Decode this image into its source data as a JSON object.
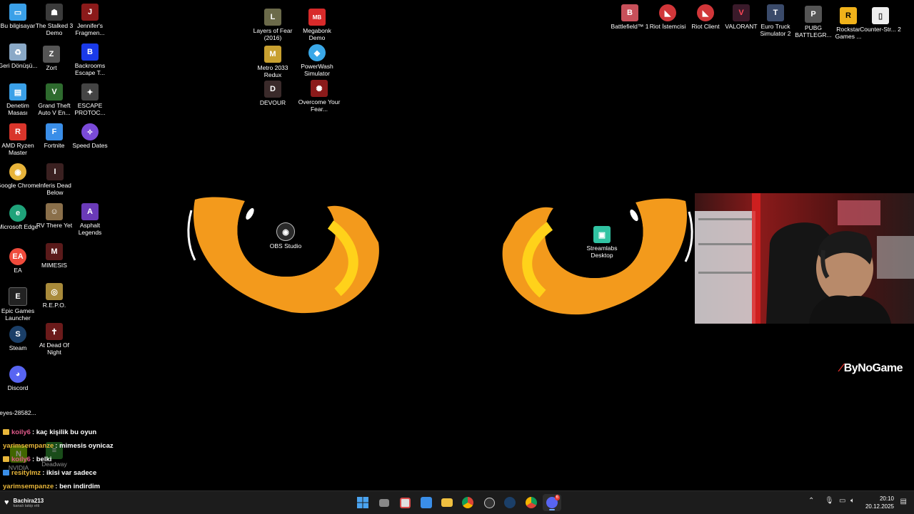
{
  "desktop": {
    "left_column_1": [
      {
        "label": "Bu bilgisayar",
        "icon": "monitor-icon",
        "color": "#3aa0e8",
        "glyph": "▭"
      },
      {
        "label": "Geri Dönüşü...",
        "icon": "recycle-bin-icon",
        "color": "#8aa9c7",
        "glyph": "♻"
      },
      {
        "label": "Denetim Masası",
        "icon": "control-panel-icon",
        "color": "#3aa0e8",
        "glyph": "▤"
      },
      {
        "label": "AMD Ryzen Master",
        "icon": "amd-ryzen-icon",
        "color": "#d9352b",
        "glyph": "R"
      },
      {
        "label": "Google Chrome",
        "icon": "chrome-icon",
        "color": "#e8b43a",
        "glyph": "◉"
      },
      {
        "label": "Microsoft Edge",
        "icon": "edge-icon",
        "color": "#1fa37a",
        "glyph": "e"
      },
      {
        "label": "EA",
        "icon": "ea-icon",
        "color": "#ef4b3c",
        "glyph": "EA"
      },
      {
        "label": "Epic Games Launcher",
        "icon": "epic-games-icon",
        "color": "#222",
        "glyph": "E"
      },
      {
        "label": "Steam",
        "icon": "steam-icon",
        "color": "#1b3f68",
        "glyph": "S"
      },
      {
        "label": "Discord",
        "icon": "discord-icon",
        "color": "#5865f2",
        "glyph": "◕"
      }
    ],
    "left_column_2": [
      {
        "label": "The Stalked 3 Demo",
        "icon": "stalked-icon",
        "color": "#3b3b3b",
        "glyph": "☗"
      },
      {
        "label": "Zort",
        "icon": "zort-icon",
        "color": "#555",
        "glyph": "Z"
      },
      {
        "label": "Grand Theft Auto V En...",
        "icon": "gta-icon",
        "color": "#2e6b2e",
        "glyph": "V"
      },
      {
        "label": "Fortnite",
        "icon": "fortnite-icon",
        "color": "#3a8ee8",
        "glyph": "F"
      },
      {
        "label": "Inferis Dead Below",
        "icon": "inferis-icon",
        "color": "#3a2020",
        "glyph": "I"
      },
      {
        "label": "RV There Yet",
        "icon": "rv-icon",
        "color": "#8a6f4a",
        "glyph": "☺"
      },
      {
        "label": "MIMESIS",
        "icon": "mimesis-icon",
        "color": "#5a1a1a",
        "glyph": "M"
      },
      {
        "label": "R.E.P.O.",
        "icon": "repo-icon",
        "color": "#a88a3a",
        "glyph": "◎"
      },
      {
        "label": "At Dead Of Night",
        "icon": "at-dead-of-night-icon",
        "color": "#6b1a1a",
        "glyph": "✝"
      }
    ],
    "left_column_3": [
      {
        "label": "Jennifer's Fragmen...",
        "icon": "jennifer-icon",
        "color": "#8b1a1a",
        "glyph": "J"
      },
      {
        "label": "Backrooms Escape T...",
        "icon": "backrooms-icon",
        "color": "#1a3ae8",
        "glyph": "B"
      },
      {
        "label": "ESCAPE PROTOC...",
        "icon": "escape-protocol-icon",
        "color": "#444",
        "glyph": "✦"
      },
      {
        "label": "Speed Dates",
        "icon": "speed-dates-icon",
        "color": "#7a4ad8",
        "glyph": "✧"
      },
      {
        "label": "Asphalt Legends",
        "icon": "asphalt-icon",
        "color": "#6a3ab8",
        "glyph": "A"
      }
    ],
    "middle_column_1": [
      {
        "label": "Layers of Fear (2016)",
        "icon": "layers-of-fear-icon",
        "color": "#6b6a4a",
        "glyph": "L"
      },
      {
        "label": "Metro 2033 Redux",
        "icon": "metro-icon",
        "color": "#c8a030",
        "glyph": "M"
      },
      {
        "label": "DEVOUR",
        "icon": "devour-icon",
        "color": "#3a2a2a",
        "glyph": "D"
      }
    ],
    "middle_column_2": [
      {
        "label": "Megabonk Demo",
        "icon": "megabonk-icon",
        "color": "#d82a2a",
        "glyph": "MB"
      },
      {
        "label": "PowerWash Simulator",
        "icon": "powerwash-icon",
        "color": "#3aa8e8",
        "glyph": "◆"
      },
      {
        "label": "Overcome Your Fear...",
        "icon": "overcome-icon",
        "color": "#8b1a1a",
        "glyph": "✺"
      }
    ],
    "center_icons": [
      {
        "label": "OBS Studio",
        "icon": "obs-icon",
        "color": "#2a2a2a",
        "glyph": "◉"
      },
      {
        "label": "Streamlabs Desktop",
        "icon": "streamlabs-icon",
        "color": "#31c3a2",
        "glyph": "▣"
      }
    ],
    "top_right": [
      {
        "label": "Battlefield™ 1",
        "icon": "battlefield-icon",
        "color": "#c8505a",
        "glyph": "B"
      },
      {
        "label": "Riot İstemcisi",
        "icon": "riot-client-icon",
        "color": "#d13639",
        "glyph": "◣"
      },
      {
        "label": "Riot Client",
        "icon": "riot-client-2-icon",
        "color": "#d13639",
        "glyph": "◣"
      },
      {
        "label": "VALORANT",
        "icon": "valorant-icon",
        "color": "#3a1a2a",
        "glyph": "V"
      },
      {
        "label": "Euro Truck Simulator 2",
        "icon": "euro-truck-icon",
        "color": "#3a4a6a",
        "glyph": "T"
      },
      {
        "label": "PUBG BATTLEGR...",
        "icon": "pubg-icon",
        "color": "#555",
        "glyph": "P"
      },
      {
        "label": "Rockstar Games ...",
        "icon": "rockstar-icon",
        "color": "#f0b21a",
        "glyph": "R"
      },
      {
        "label": "Counter-Str... 2",
        "icon": "counter-strike-icon",
        "color": "#eee",
        "glyph": "▯"
      }
    ],
    "partial_icons": [
      {
        "label": "eyes-28582...",
        "icon": "image-file-icon"
      },
      {
        "label": "NVIDIA",
        "icon": "nvidia-icon"
      },
      {
        "label": "Deadway",
        "icon": "deadway-icon"
      }
    ]
  },
  "overlay": {
    "brand": "ByNoGame",
    "chat": [
      {
        "user": "koily6",
        "message": ": kaç kişilik bu oyun",
        "color": "#e05a8a",
        "badge": true
      },
      {
        "user": "yarimsempanze",
        "message": ": mimesis oynicaz",
        "color": "#e8b63a",
        "badge": false
      },
      {
        "user": "koily6",
        "message": ": belki",
        "color": "#e05a8a",
        "badge": true
      },
      {
        "user": "resitylmz",
        "message": ": ikisi var sadece",
        "color": "#e8b63a",
        "badge": true
      },
      {
        "user": "yarimsempanze",
        "message": ": ben indirdim",
        "color": "#e8b63a",
        "badge": false
      }
    ]
  },
  "taskbar": {
    "widget": {
      "title": "Bachira213",
      "subtitle": "kanalı takip etti"
    },
    "apps": [
      {
        "name": "start-button",
        "color": "#4aa3f0"
      },
      {
        "name": "task-view-button",
        "color": "#888"
      },
      {
        "name": "snipping-tool-button",
        "color": "#d84a4a"
      },
      {
        "name": "photos-button",
        "color": "#3a8ee8"
      },
      {
        "name": "file-explorer-button",
        "color": "#f0c040"
      },
      {
        "name": "chrome-button",
        "color": "#e8b43a"
      },
      {
        "name": "obs-button",
        "color": "#555"
      },
      {
        "name": "steam-button",
        "color": "#1b3f68"
      },
      {
        "name": "chrome-2-button",
        "color": "#3aa870"
      },
      {
        "name": "discord-button",
        "color": "#5865f2"
      }
    ],
    "discord_badge": "6",
    "time": "20:10",
    "date": "20.12.2025"
  }
}
